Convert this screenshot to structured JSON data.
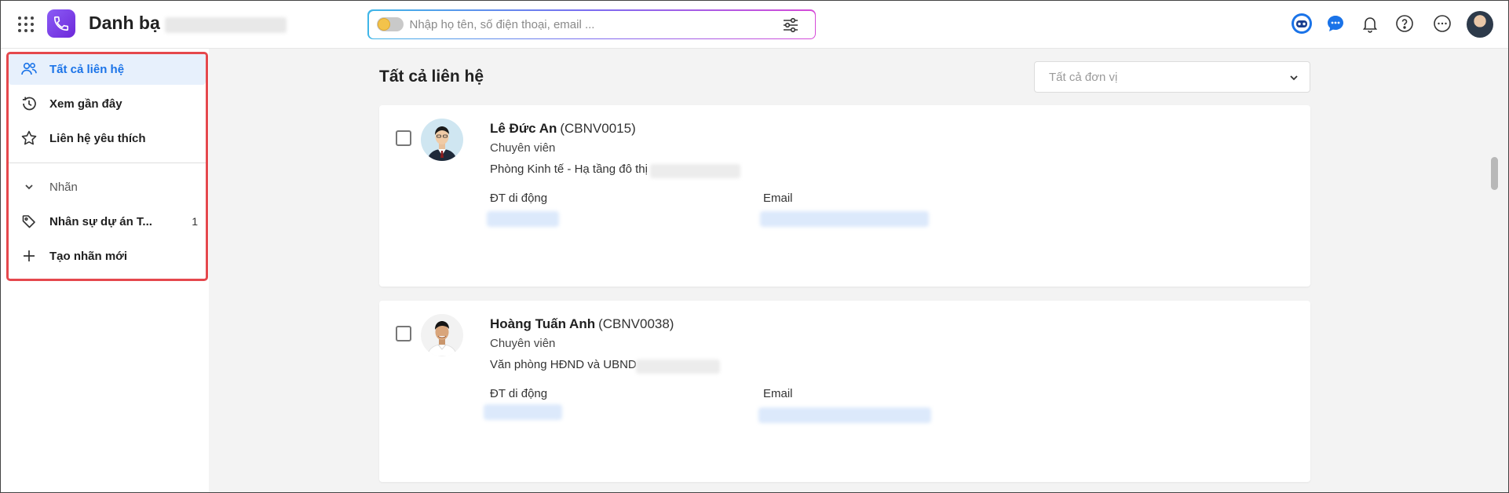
{
  "header": {
    "app_title": "Danh bạ",
    "search": {
      "placeholder": "Nhập họ tên, số điện thoại, email ..."
    },
    "icons": [
      "apps-grid-icon",
      "phone-app-icon",
      "ai-assistant-icon",
      "chat-icon",
      "bell-icon",
      "help-icon",
      "more-icon",
      "user-avatar"
    ]
  },
  "sidebar": {
    "items": [
      {
        "label": "Tất cả liên hệ",
        "icon": "contacts-icon",
        "active": true
      },
      {
        "label": "Xem gần đây",
        "icon": "history-icon"
      },
      {
        "label": "Liên hệ yêu thích",
        "icon": "star-icon"
      }
    ],
    "labels_section": {
      "label": "Nhãn",
      "icon": "chevron-down-icon"
    },
    "tags": [
      {
        "label": "Nhân sự dự án T...",
        "count": "1",
        "icon": "tag-icon"
      }
    ],
    "create_label": "Tạo nhãn mới"
  },
  "main": {
    "title": "Tất cả liên hệ",
    "unit_filter_placeholder": "Tất cả đơn vị",
    "contacts": [
      {
        "name": "Lê Đức An",
        "code": "(CBNV0015)",
        "position": "Chuyên viên",
        "department": "Phòng Kinh tế - Hạ tầng đô thị",
        "phone_label": "ĐT di động",
        "email_label": "Email"
      },
      {
        "name": "Hoàng Tuấn Anh",
        "code": "(CBNV0038)",
        "position": "Chuyên viên",
        "department": "Văn phòng HĐND và UBND",
        "phone_label": "ĐT di động",
        "email_label": "Email"
      }
    ]
  },
  "colors": {
    "accent": "#1a73e8",
    "active_bg": "#e7f0fc",
    "highlight_border": "#e5484d",
    "brand_purple": "#7c3aed"
  }
}
